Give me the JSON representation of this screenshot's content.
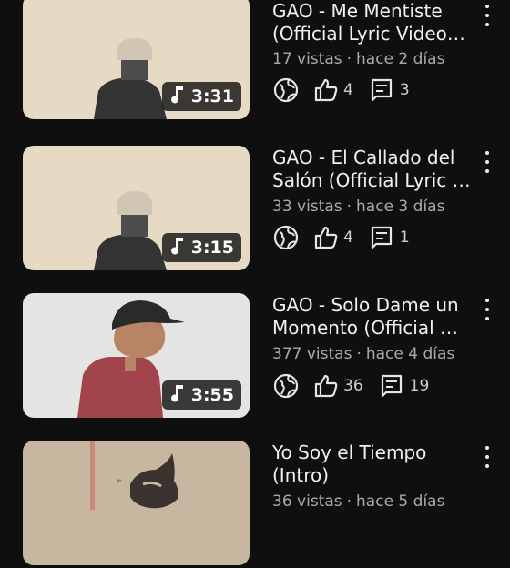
{
  "videos": [
    {
      "title_line1": "GAO - Me Mentiste",
      "title_line2": "(Official Lyric Video…",
      "views": "17 vistas",
      "age": "hace 2 días",
      "likes": "4",
      "comments": "3",
      "duration": "3:31",
      "duration_icon": "music-note-icon",
      "thumbnail": "beige background with hooded figure"
    },
    {
      "title_line1": "GAO - El Callado del",
      "title_line2": "Salón (Official Lyric …",
      "views": "33 vistas",
      "age": "hace 3 días",
      "likes": "4",
      "comments": "1",
      "duration": "3:15",
      "duration_icon": "music-note-icon",
      "thumbnail": "beige background with hooded figure"
    },
    {
      "title_line1": "GAO - Solo Dame un",
      "title_line2": "Momento (Official …",
      "views": "377 vistas",
      "age": "hace 4 días",
      "likes": "36",
      "comments": "19",
      "duration": "3:55",
      "duration_icon": "music-note-icon",
      "thumbnail": "man in cap and red hoodie"
    },
    {
      "title_line1": "Yo Soy el Tiempo",
      "title_line2": "(Intro)",
      "views": "36 vistas",
      "age": "hace 5 días",
      "thumbnail": "sepia illustration"
    }
  ],
  "icons": {
    "visibility": "globe-icon",
    "likes": "thumbs-up-icon",
    "comments": "comment-icon",
    "more": "more-vert-icon"
  },
  "colors": {
    "background": "#0f0f0f",
    "text_primary": "#f1f1f1",
    "text_secondary": "#aaaaaa",
    "thumb_beige": "#e6dac4",
    "thumb_light": "#e4e4e2"
  }
}
